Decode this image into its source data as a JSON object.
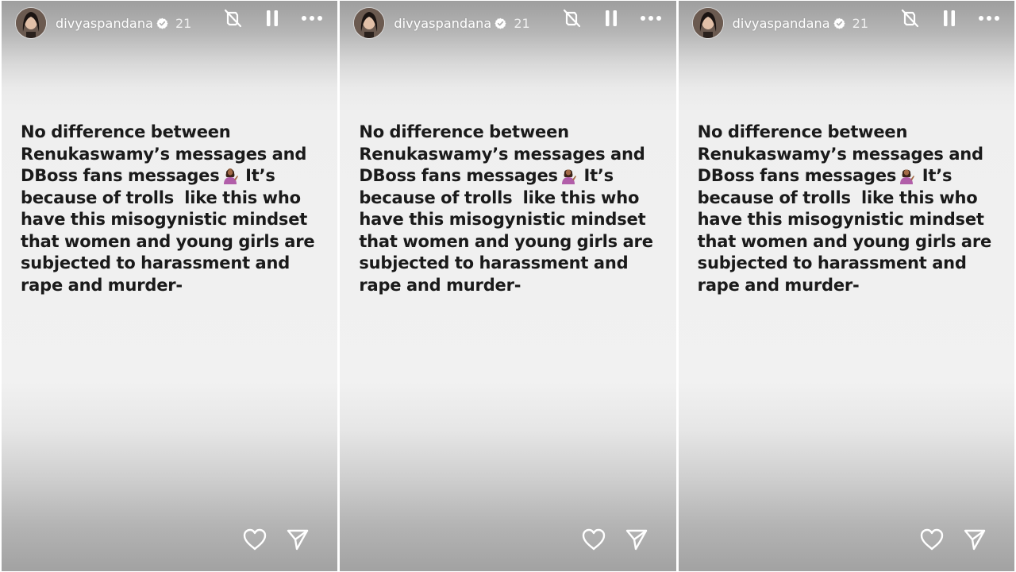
{
  "stories": [
    {
      "username": "divyaspandana",
      "time_ago": "21",
      "text_before_emoji": "No difference between\nRenukaswamy’s messages and\nDBoss fans messages",
      "text_after_emoji": " It’s\nbecause of trolls  like this who\nhave this misogynistic mindset\nthat women and young girls are\nsubjected to harassment and\nrape and murder-"
    },
    {
      "username": "divyaspandana",
      "time_ago": "21",
      "text_before_emoji": "No difference between\nRenukaswamy’s messages and\nDBoss fans messages",
      "text_after_emoji": " It’s\nbecause of trolls  like this who\nhave this misogynistic mindset\nthat women and young girls are\nsubjected to harassment and\nrape and murder-"
    },
    {
      "username": "divyaspandana",
      "time_ago": "21",
      "text_before_emoji": "No difference between\nRenukaswamy’s messages and\nDBoss fans messages",
      "text_after_emoji": " It’s\nbecause of trolls  like this who\nhave this misogynistic mindset\nthat women and young girls are\nsubjected to harassment and\nrape and murder-"
    }
  ],
  "icons": {
    "verified": "verified-badge-icon",
    "mute": "sound-off-icon",
    "pause": "pause-icon",
    "more": "more-options-icon",
    "like": "heart-icon",
    "share": "send-icon",
    "emoji": "person-tipping-hand-emoji"
  },
  "colors": {
    "text": "#1a1a1a",
    "header_text": "#ffffff",
    "background": "#f1f1f1"
  }
}
